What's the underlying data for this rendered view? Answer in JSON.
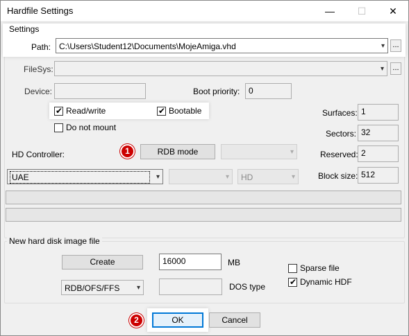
{
  "window": {
    "title": "Hardfile Settings",
    "min_glyph": "—",
    "max_glyph": "☐",
    "close_glyph": "✕"
  },
  "settings": {
    "group_label": "Settings",
    "path_label": "Path:",
    "path_value": "C:\\Users\\Student12\\Documents\\MojeAmiga.vhd",
    "browse_label": "...",
    "filesys_label": "FileSys:",
    "filesys_value": "",
    "device_label": "Device:",
    "device_value": "",
    "boot_priority_label": "Boot priority:",
    "boot_priority_value": "0",
    "read_write_label": "Read/write",
    "read_write_checked": true,
    "bootable_label": "Bootable",
    "bootable_checked": true,
    "do_not_mount_label": "Do not mount",
    "do_not_mount_checked": false,
    "hd_controller_label": "HD Controller:",
    "rdb_mode_label": "RDB mode",
    "controller_select_value": "UAE",
    "unit_select_value": "",
    "type_select_value": "HD",
    "surfaces_label": "Surfaces:",
    "surfaces_value": "1",
    "sectors_label": "Sectors:",
    "sectors_value": "32",
    "reserved_label": "Reserved:",
    "reserved_value": "2",
    "block_size_label": "Block size:",
    "block_size_value": "512"
  },
  "new_image": {
    "group_label": "New hard disk image file",
    "create_label": "Create",
    "size_value": "16000",
    "size_unit": "MB",
    "fs_select_value": "RDB/OFS/FFS",
    "dos_type_value": "",
    "dos_type_label": "DOS type",
    "sparse_label": "Sparse file",
    "sparse_checked": false,
    "dynamic_label": "Dynamic HDF",
    "dynamic_checked": true
  },
  "footer": {
    "ok_label": "OK",
    "cancel_label": "Cancel"
  },
  "annotations": {
    "badge_1": "1",
    "badge_2": "2",
    "badge_color": "#cc0000"
  },
  "icons": {
    "dropdown": "▾",
    "check": "✔"
  }
}
